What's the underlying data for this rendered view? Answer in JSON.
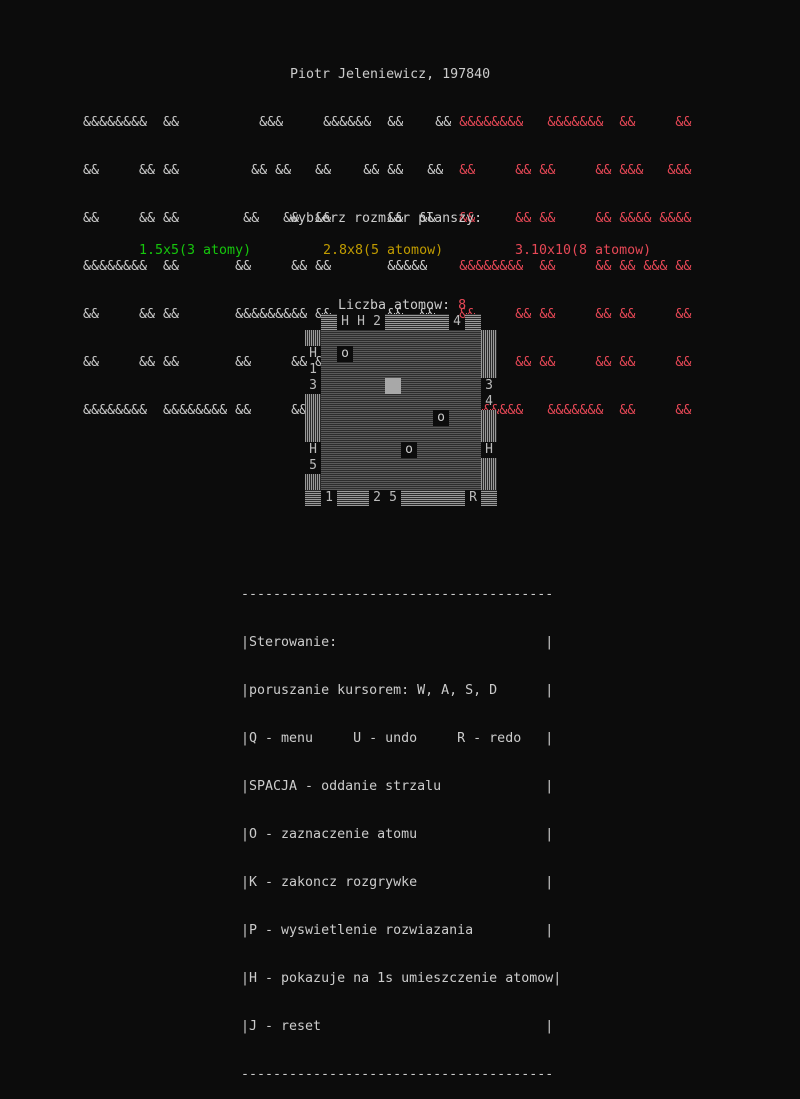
{
  "author": "Piotr Jeleniewicz, 197840",
  "banner": {
    "left_rows": [
      "&&&&&&&&  &&          &&&     &&&&&&  &&    && ",
      "&&     && &&         && &&   &&    && &&   &&  ",
      "&&     && &&        &&   &&  &&       &&  &&   ",
      "&&&&&&&&  &&       &&     && &&       &&&&&    ",
      "&&     && &&       &&&&&&&&& &&       &&  &&   ",
      "&&     && &&       &&     && &&    && &&   &&  ",
      "&&&&&&&&  &&&&&&&& &&     &&  &&&&&&  &&    && "
    ],
    "right_rows": [
      "&&&&&&&&   &&&&&&&  &&     &&",
      "&&     && &&     && &&&   &&&",
      "&&     && &&     && &&&& &&&&",
      "&&&&&&&&  &&     && && &&& &&",
      "&&     && &&     && &&     &&",
      "&&     && &&     && &&     &&",
      "&&&&&&&&   &&&&&&&  &&     &&"
    ],
    "colors": {
      "left": "#cccccc",
      "right": "#e74856"
    }
  },
  "menu": {
    "prompt": "wybierz rozmiar planszy:",
    "options": [
      {
        "label": "1.5x5(3 atomy)",
        "color": "#16c60c"
      },
      {
        "label": "2.8x8(5 atomow)",
        "color": "#c19c00"
      },
      {
        "label": "3.10x10(8 atomow)",
        "color": "#e74856"
      }
    ]
  },
  "game": {
    "atoms_label": "Liczba atomow: ",
    "atoms_count": "8",
    "board_markers": {
      "top": [
        "H",
        "H",
        "2",
        "4"
      ],
      "left": [
        "H",
        "1",
        "3",
        "H",
        "5"
      ],
      "right": [
        "3",
        "4",
        "H"
      ],
      "bottom": [
        "1",
        "2",
        "5",
        "R"
      ]
    },
    "atom_symbol": "o"
  },
  "controls": {
    "border": "---------------------------------------",
    "title": "Sterowanie:",
    "lines": [
      "poruszanie kursorem: W, A, S, D",
      "Q - menu     U - undo     R - redo",
      "SPACJA - oddanie strzalu",
      "O - zaznaczenie atomu",
      "K - zakoncz rozgrywke",
      "P - wyswietlenie rozwiazania",
      "H - pokazuje na 1s umieszczenie atomow",
      "J - reset"
    ]
  }
}
